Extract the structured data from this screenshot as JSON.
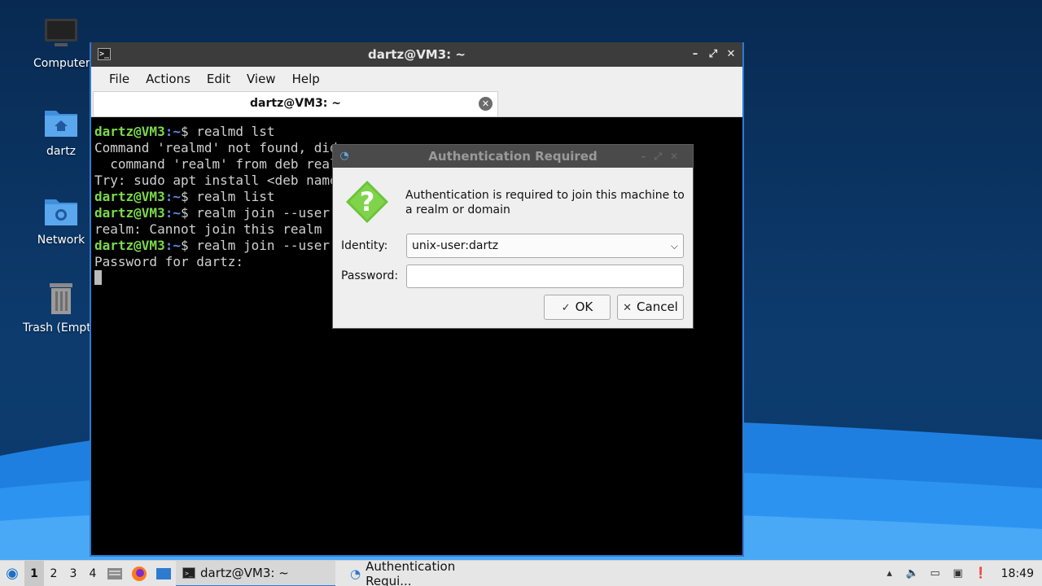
{
  "desktop": {
    "icons": [
      {
        "label": "Computer",
        "icon": "monitor-icon"
      },
      {
        "label": "dartz",
        "icon": "home-folder-icon"
      },
      {
        "label": "Network",
        "icon": "network-folder-icon"
      },
      {
        "label": "Trash (Empty)",
        "icon": "trash-icon"
      }
    ]
  },
  "terminal": {
    "title": "dartz@VM3: ~",
    "menu": [
      "File",
      "Actions",
      "Edit",
      "View",
      "Help"
    ],
    "tab_label": "dartz@VM3: ~",
    "prompt_user": "dartz@VM3",
    "prompt_path": ":~",
    "prompt_sign": "$ ",
    "lines": [
      {
        "type": "cmd",
        "text": "realmd lst"
      },
      {
        "type": "out",
        "text": "Command 'realmd' not found, did you mean:"
      },
      {
        "type": "out",
        "text": "  command 'realm' from deb realmd"
      },
      {
        "type": "out",
        "text": "Try: sudo apt install <deb name>"
      },
      {
        "type": "cmd",
        "text": "realm list"
      },
      {
        "type": "cmd",
        "text": "realm join --user"
      },
      {
        "type": "out",
        "text": "realm: Cannot join this realm"
      },
      {
        "type": "cmd",
        "text": "realm join --user"
      },
      {
        "type": "out",
        "text": "Password for dartz:"
      }
    ]
  },
  "auth_dialog": {
    "title": "Authentication Required",
    "message": "Authentication is required to join this machine to a realm or domain",
    "identity_label": "Identity:",
    "identity_value": "unix-user:dartz",
    "password_label": "Password:",
    "password_value": "",
    "ok_label": "OK",
    "cancel_label": "Cancel",
    "icon": "question-icon"
  },
  "taskbar": {
    "workspaces": [
      "1",
      "2",
      "3",
      "4"
    ],
    "active_workspace": "1",
    "tasks": [
      {
        "label": "dartz@VM3: ~",
        "icon": "terminal-icon"
      },
      {
        "label": "Authentication Requi...",
        "icon": "auth-icon"
      }
    ],
    "clock": "18:49"
  },
  "colors": {
    "accent": "#2e7ad1",
    "prompt_user": "#7cd94a",
    "prompt_path": "#5b8ee0",
    "question_icon": "#6cc33a"
  }
}
